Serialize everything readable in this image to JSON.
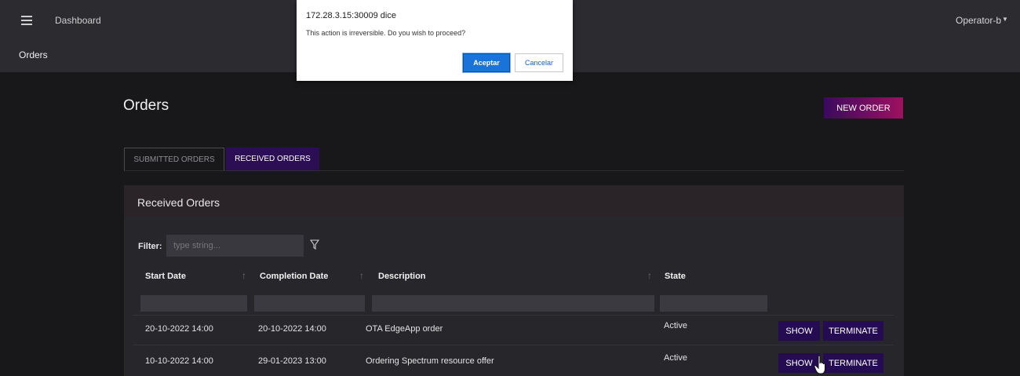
{
  "header": {
    "dashboard": "Dashboard",
    "section": "Orders",
    "user": "Operator-b"
  },
  "dialog": {
    "origin": "172.28.3.15:30009 dice",
    "message": "This action is irreversible. Do you wish to proceed?",
    "ok_label": "Aceptar",
    "cancel_label": "Cancelar"
  },
  "page": {
    "title": "Orders",
    "new_order_label": "NEW ORDER",
    "tabs": [
      {
        "label": "SUBMITTED ORDERS",
        "active": false
      },
      {
        "label": "RECEIVED ORDERS",
        "active": true
      }
    ]
  },
  "panel": {
    "title": "Received Orders",
    "filter_label": "Filter:",
    "filter_placeholder": "type string...",
    "columns": [
      "Start Date",
      "Completion Date",
      "Description",
      "State"
    ],
    "rows": [
      {
        "start": "20-10-2022 14:00",
        "completion": "20-10-2022 14:00",
        "description": "OTA EdgeApp order",
        "state": "Active",
        "show": "SHOW",
        "terminate": "TERMINATE"
      },
      {
        "start": "10-10-2022 14:00",
        "completion": "29-01-2023 13:00",
        "description": "Ordering Spectrum resource offer",
        "state": "Active",
        "show": "SHOW",
        "terminate": "TERMINATE"
      }
    ]
  },
  "colors": {
    "accent_tab": "#2c0e54",
    "action_button": "#250c52",
    "dialog_primary": "#1a73d9"
  },
  "icons": [
    "hamburger-menu-icon",
    "caret-down-icon",
    "funnel-filter-icon",
    "sort-arrow-icon",
    "hand-cursor-icon"
  ]
}
